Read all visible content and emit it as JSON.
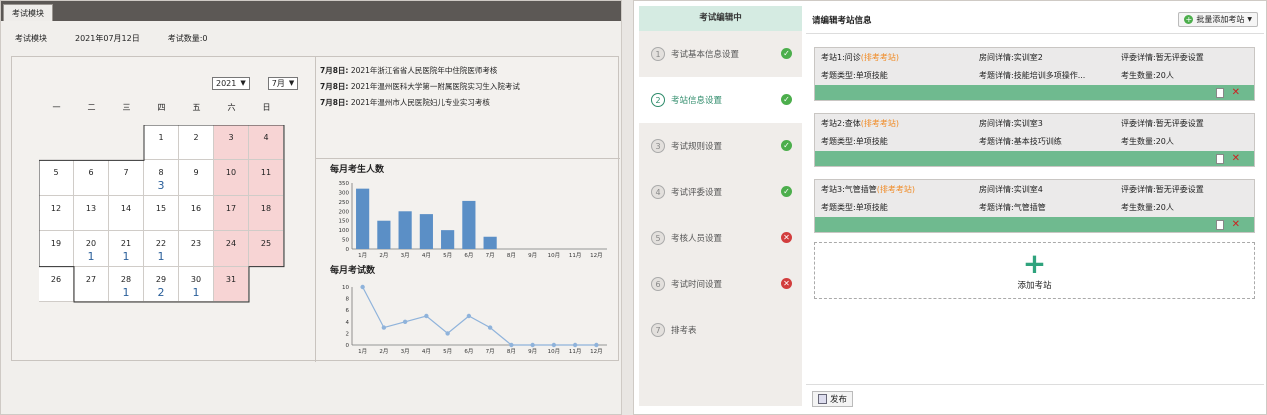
{
  "left": {
    "tab_label": "考试模块",
    "info": {
      "module": "考试模块",
      "date": "2021年07月12日",
      "count": "考试数量:0"
    },
    "year": "2021",
    "month": "7月",
    "weekdays": [
      "一",
      "二",
      "三",
      "四",
      "五",
      "六",
      "日"
    ],
    "calendar": [
      [
        null,
        null,
        null,
        {
          "d": "1"
        },
        {
          "d": "2"
        },
        {
          "d": "3",
          "we": true
        },
        {
          "d": "4",
          "we": true
        }
      ],
      [
        {
          "d": "5"
        },
        {
          "d": "6"
        },
        {
          "d": "7"
        },
        {
          "d": "8",
          "c": "3"
        },
        {
          "d": "9"
        },
        {
          "d": "10",
          "we": true
        },
        {
          "d": "11",
          "we": true
        }
      ],
      [
        {
          "d": "12"
        },
        {
          "d": "13"
        },
        {
          "d": "14"
        },
        {
          "d": "15"
        },
        {
          "d": "16"
        },
        {
          "d": "17",
          "we": true
        },
        {
          "d": "18",
          "we": true
        }
      ],
      [
        {
          "d": "19"
        },
        {
          "d": "20",
          "c": "1"
        },
        {
          "d": "21",
          "c": "1"
        },
        {
          "d": "22",
          "c": "1"
        },
        {
          "d": "23"
        },
        {
          "d": "24",
          "we": true
        },
        {
          "d": "25",
          "we": true
        }
      ],
      [
        {
          "d": "26"
        },
        {
          "d": "27"
        },
        {
          "d": "28",
          "c": "1"
        },
        {
          "d": "29",
          "c": "2"
        },
        {
          "d": "30",
          "c": "1"
        },
        {
          "d": "31",
          "we": true
        },
        null
      ]
    ],
    "notices": [
      {
        "date": "7月8日:",
        "text": "2021年浙江省省人民医院年中住院医师考核"
      },
      {
        "date": "7月8日:",
        "text": "2021年温州医科大学第一附属医院实习生入院考试"
      },
      {
        "date": "7月8日:",
        "text": "2021年温州市人民医院妇儿专业实习考核"
      }
    ]
  },
  "chart_data": [
    {
      "type": "bar",
      "title": "每月考生人数",
      "categories": [
        "1月",
        "2月",
        "3月",
        "4月",
        "5月",
        "6月",
        "7月",
        "8月",
        "9月",
        "10月",
        "11月",
        "12月"
      ],
      "values": [
        320,
        150,
        200,
        185,
        100,
        255,
        65,
        0,
        0,
        0,
        0,
        0
      ],
      "ylim": [
        0,
        350
      ],
      "yticks": [
        0,
        50,
        100,
        150,
        200,
        250,
        300,
        350
      ],
      "color": "#5b8fc6"
    },
    {
      "type": "line",
      "title": "每月考试数",
      "categories": [
        "1月",
        "2月",
        "3月",
        "4月",
        "5月",
        "6月",
        "7月",
        "8月",
        "9月",
        "10月",
        "11月",
        "12月"
      ],
      "values": [
        10,
        3,
        4,
        5,
        2,
        5,
        3,
        0,
        0,
        0,
        0,
        0
      ],
      "ylim": [
        0,
        10
      ],
      "yticks": [
        0,
        2,
        4,
        6,
        8,
        10
      ],
      "color": "#8fb3db"
    }
  ],
  "right": {
    "steps_title": "考试编辑中",
    "steps": [
      {
        "num": "1",
        "label": "考试基本信息设置",
        "status": "ok"
      },
      {
        "num": "2",
        "label": "考站信息设置",
        "status": "ok",
        "active": true
      },
      {
        "num": "3",
        "label": "考试规则设置",
        "status": "ok"
      },
      {
        "num": "4",
        "label": "考试评委设置",
        "status": "ok"
      },
      {
        "num": "5",
        "label": "考核人员设置",
        "status": "bad"
      },
      {
        "num": "6",
        "label": "考试时间设置",
        "status": "bad"
      },
      {
        "num": "7",
        "label": "排考表",
        "status": ""
      }
    ],
    "header_title": "请编辑考站信息",
    "batch_button": "批量添加考站",
    "stations": [
      {
        "name": "考站1:问诊",
        "tag": "(排考考站)",
        "room": "房间详情:实训室2",
        "judge": "评委详情:暂无评委设置",
        "type": "考题类型:单项技能",
        "exam": "考题详情:技能培训多项操作...",
        "count": "考生数量:20人"
      },
      {
        "name": "考站2:查体",
        "tag": "(排考考站)",
        "room": "房间详情:实训室3",
        "judge": "评委详情:暂无评委设置",
        "type": "考题类型:单项技能",
        "exam": "考题详情:基本技巧训练",
        "count": "考生数量:20人"
      },
      {
        "name": "考站3:气管插管",
        "tag": "(排考考站)",
        "room": "房间详情:实训室4",
        "judge": "评委详情:暂无评委设置",
        "type": "考题类型:单项技能",
        "exam": "考题详情:气管插管",
        "count": "考生数量:20人"
      }
    ],
    "add_station": "添加考站",
    "publish": "发布"
  }
}
